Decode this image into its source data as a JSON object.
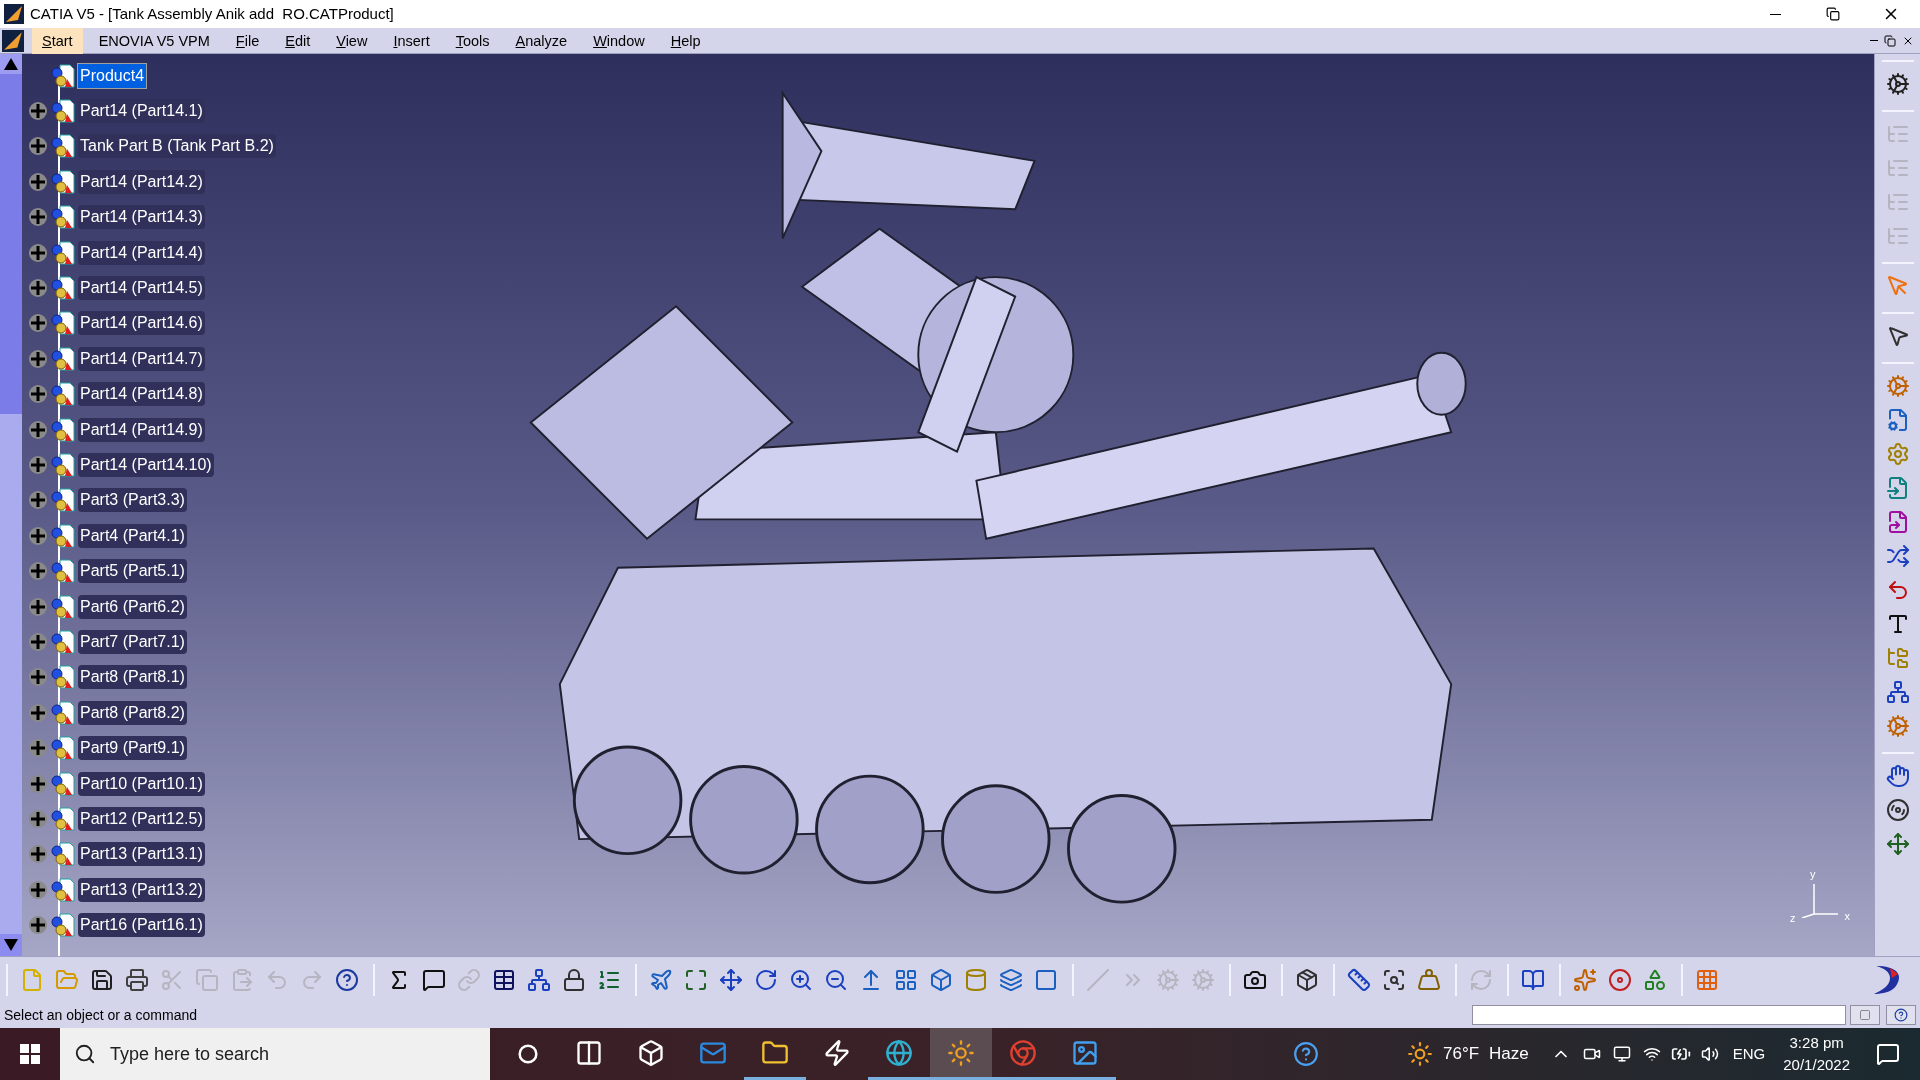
{
  "window": {
    "title": "CATIA V5 - [Tank Assembly Anik add  RO.CATProduct]"
  },
  "menu": [
    {
      "label": "Start",
      "selected": true,
      "mnemonic": true
    },
    {
      "label": "ENOVIA V5 VPM",
      "selected": false,
      "mnemonic": false
    },
    {
      "label": "File",
      "selected": false,
      "mnemonic": true
    },
    {
      "label": "Edit",
      "selected": false,
      "mnemonic": true
    },
    {
      "label": "View",
      "selected": false,
      "mnemonic": true
    },
    {
      "label": "Insert",
      "selected": false,
      "mnemonic": true
    },
    {
      "label": "Tools",
      "selected": false,
      "mnemonic": true
    },
    {
      "label": "Analyze",
      "selected": false,
      "mnemonic": true
    },
    {
      "label": "Window",
      "selected": false,
      "mnemonic": true
    },
    {
      "label": "Help",
      "selected": false,
      "mnemonic": true
    }
  ],
  "tree": {
    "root": {
      "label": "Product4",
      "selected": true,
      "children": [
        {
          "label": "Part14 (Part14.1)",
          "selected": false
        },
        {
          "label": "Tank Part B (Tank Part B.2)",
          "selected": false
        },
        {
          "label": "Part14 (Part14.2)",
          "selected": false
        },
        {
          "label": "Part14 (Part14.3)",
          "selected": false
        },
        {
          "label": "Part14 (Part14.4)",
          "selected": false
        },
        {
          "label": "Part14 (Part14.5)",
          "selected": false
        },
        {
          "label": "Part14 (Part14.6)",
          "selected": false
        },
        {
          "label": "Part14 (Part14.7)",
          "selected": false
        },
        {
          "label": "Part14 (Part14.8)",
          "selected": false
        },
        {
          "label": "Part14 (Part14.9)",
          "selected": false
        },
        {
          "label": "Part14 (Part14.10)",
          "selected": false
        },
        {
          "label": "Part3 (Part3.3)",
          "selected": false
        },
        {
          "label": "Part4 (Part4.1)",
          "selected": false
        },
        {
          "label": "Part5 (Part5.1)",
          "selected": false
        },
        {
          "label": "Part6 (Part6.2)",
          "selected": false
        },
        {
          "label": "Part7 (Part7.1)",
          "selected": false
        },
        {
          "label": "Part8 (Part8.1)",
          "selected": false
        },
        {
          "label": "Part8 (Part8.2)",
          "selected": false
        },
        {
          "label": "Part9 (Part9.1)",
          "selected": false
        },
        {
          "label": "Part10 (Part10.1)",
          "selected": false
        },
        {
          "label": "Part12 (Part12.5)",
          "selected": false
        },
        {
          "label": "Part13 (Part13.1)",
          "selected": false
        },
        {
          "label": "Part13 (Part13.2)",
          "selected": false
        },
        {
          "label": "Part16 (Part16.1)",
          "selected": false
        }
      ]
    }
  },
  "toolbar_bottom": [
    [
      {
        "disabled": false
      },
      {
        "disabled": false
      },
      {
        "disabled": false
      },
      {
        "disabled": false
      },
      {
        "disabled": true
      },
      {
        "disabled": true
      },
      {
        "disabled": true
      },
      {
        "disabled": true
      },
      {
        "disabled": true
      },
      {
        "disabled": false
      }
    ],
    [
      {
        "disabled": false
      },
      {
        "disabled": false
      },
      {
        "disabled": true
      },
      {
        "disabled": false
      },
      {
        "disabled": false
      },
      {
        "disabled": false
      },
      {
        "disabled": false
      }
    ],
    [
      {
        "disabled": false
      },
      {
        "disabled": false
      },
      {
        "disabled": false
      },
      {
        "disabled": false
      },
      {
        "disabled": false
      },
      {
        "disabled": false
      },
      {
        "disabled": false
      },
      {
        "disabled": false
      },
      {
        "disabled": false
      },
      {
        "disabled": false
      },
      {
        "disabled": false
      },
      {
        "disabled": false
      }
    ],
    [
      {
        "disabled": true
      },
      {
        "disabled": true
      },
      {
        "disabled": true
      },
      {
        "disabled": true
      }
    ],
    [
      {
        "disabled": false
      }
    ],
    [
      {
        "disabled": false
      }
    ],
    [
      {
        "disabled": false
      },
      {
        "disabled": false
      },
      {
        "disabled": false
      }
    ],
    [
      {
        "disabled": true
      }
    ],
    [
      {
        "disabled": false
      }
    ],
    [
      {
        "disabled": false
      },
      {
        "disabled": false
      },
      {
        "disabled": false
      }
    ],
    [
      {
        "disabled": false
      }
    ]
  ],
  "toolbar_right": [
    [
      {
        "disabled": false
      }
    ],
    [
      {
        "disabled": true
      },
      {
        "disabled": true
      },
      {
        "disabled": true
      },
      {
        "disabled": true
      }
    ],
    [
      {
        "disabled": false
      }
    ],
    [
      {
        "disabled": false
      }
    ],
    [
      {
        "disabled": false
      },
      {
        "disabled": false
      },
      {
        "disabled": false
      },
      {
        "disabled": false
      },
      {
        "disabled": false
      },
      {
        "disabled": false
      },
      {
        "disabled": false
      },
      {
        "disabled": false
      },
      {
        "disabled": false
      },
      {
        "disabled": false
      },
      {
        "disabled": false
      }
    ],
    [
      {
        "disabled": false
      },
      {
        "disabled": false
      },
      {
        "disabled": false
      }
    ]
  ],
  "axis_labels": [
    "y",
    "x",
    "z"
  ],
  "status_bar": {
    "message": "Select an object or a command"
  },
  "taskbar": {
    "search": {
      "placeholder": "Type here to search"
    },
    "apps": [
      {
        "selected": false,
        "running": false
      },
      {
        "selected": false,
        "running": false
      },
      {
        "selected": false,
        "running": false
      },
      {
        "selected": false,
        "running": true
      },
      {
        "selected": false,
        "running": false
      },
      {
        "selected": false,
        "running": true
      },
      {
        "selected": true,
        "running": true
      },
      {
        "selected": false,
        "running": true
      },
      {
        "selected": false,
        "running": true
      }
    ],
    "weather": {
      "temperature": "76°F",
      "condition": "Haze"
    },
    "language": "ENG",
    "time": "3:28 pm",
    "date": "20/1/2022"
  }
}
